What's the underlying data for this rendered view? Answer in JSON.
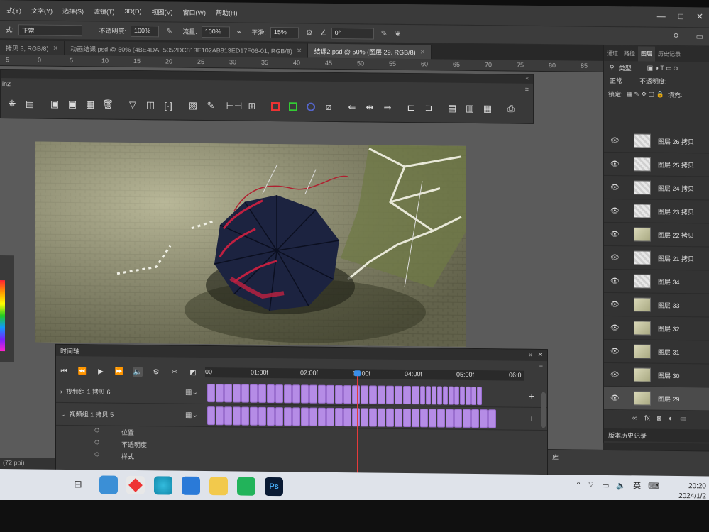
{
  "menubar": {
    "items": [
      "式(Y)",
      "文字(Y)",
      "选择(S)",
      "滤镜(T)",
      "3D(D)",
      "视图(V)",
      "窗口(W)",
      "帮助(H)"
    ],
    "window_controls": [
      "—",
      "□",
      "✕"
    ]
  },
  "options_bar": {
    "mode_label": "式:",
    "mode_value": "正常",
    "opacity_label": "不透明度:",
    "opacity_value": "100%",
    "flow_label": "流量:",
    "flow_value": "100%",
    "smooth_label": "平滑:",
    "smooth_value": "15%",
    "angle_value": "0°"
  },
  "tabs": [
    {
      "label": "拷贝 3, RGB/8)",
      "active": false
    },
    {
      "label": "动画结课.psd @ 50% (4BE4DAF5052DC813E102AB813ED17F06-01, RGB/8)",
      "active": false
    },
    {
      "label": "结课2.psd @ 50% (图层 29, RGB/8)",
      "active": true
    }
  ],
  "ruler": [
    "5",
    "0",
    "5",
    "10",
    "15",
    "20",
    "25",
    "30",
    "35",
    "40",
    "45",
    "50",
    "55",
    "60",
    "65",
    "70",
    "75",
    "80",
    "85"
  ],
  "tool_panel": {
    "title": "in2",
    "head_controls": [
      "«",
      "≡"
    ]
  },
  "timeline": {
    "title": "时间轴",
    "head_controls": [
      "«",
      "✕",
      "≡"
    ],
    "time_labels": [
      "00",
      "01:00f",
      "02:00f",
      "03:00f",
      "04:00f",
      "05:00f",
      "06:0"
    ],
    "tracks": [
      {
        "label": "视频组 1 拷贝 6",
        "arrow": "›"
      },
      {
        "label": "视频组 1 拷贝 5",
        "arrow": "⌄"
      }
    ],
    "properties": [
      "位置",
      "不透明度",
      "样式"
    ]
  },
  "layers_panel": {
    "tabs": [
      "通道",
      "路径",
      "图层",
      "历史记录"
    ],
    "filter_label": "类型",
    "blend_mode": "正常",
    "opacity_label": "不透明度:",
    "lock_label": "锁定:",
    "fill_label": "填充:",
    "layers": [
      {
        "name": "图层 26 拷贝",
        "thumb": "pattern",
        "selected": false
      },
      {
        "name": "图层 25 拷贝",
        "thumb": "pattern",
        "selected": false
      },
      {
        "name": "图层 24 拷贝",
        "thumb": "pattern",
        "selected": false
      },
      {
        "name": "图层 23 拷贝",
        "thumb": "pattern",
        "selected": false
      },
      {
        "name": "图层 22 拷贝",
        "thumb": "image",
        "selected": false
      },
      {
        "name": "图层 21 拷贝",
        "thumb": "pattern",
        "selected": false
      },
      {
        "name": "图层 34",
        "thumb": "pattern",
        "selected": false
      },
      {
        "name": "图层 33",
        "thumb": "image",
        "selected": false
      },
      {
        "name": "图层 32",
        "thumb": "image",
        "selected": false
      },
      {
        "name": "图层 31",
        "thumb": "image",
        "selected": false
      },
      {
        "name": "图层 30",
        "thumb": "image",
        "selected": false
      },
      {
        "name": "图层 29",
        "thumb": "image",
        "selected": true
      }
    ],
    "history_tab": "版本历史记录"
  },
  "lower_panel_label": "库",
  "status": "(72 ppi)",
  "taskbar": {
    "tray_lang": "英",
    "time": "20:20",
    "date": "2024/1/2"
  }
}
